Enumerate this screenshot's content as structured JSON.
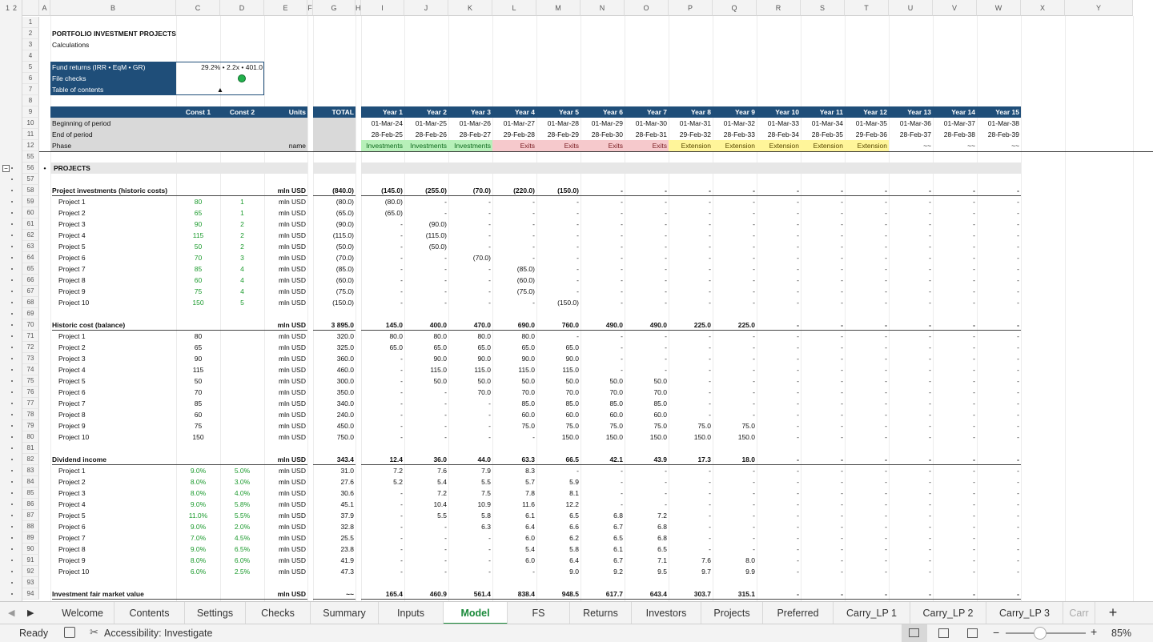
{
  "colors": {
    "accent": "#1a8a3a",
    "header": "#1f4e79",
    "investments": "#b7f0b9",
    "exits": "#f6c9cc",
    "extension": "#fff59a",
    "inputs": "#1a9a2c"
  },
  "outline_levels": [
    "1",
    "2"
  ],
  "columns": [
    "A",
    "B",
    "C",
    "D",
    "E",
    "F",
    "G",
    "H",
    "I",
    "J",
    "K",
    "L",
    "M",
    "N",
    "O",
    "P",
    "Q",
    "R",
    "S",
    "T",
    "U",
    "V",
    "W",
    "X",
    "Y"
  ],
  "title": "PORTFOLIO INVESTMENT PROJECTS",
  "subtitle": "Calculations",
  "summary": {
    "fund_returns_label": "Fund returns (IRR • EqM • GR)",
    "fund_returns_value": "29.2% • 2.2x • 401.0",
    "file_checks_label": "File checks",
    "toc_label": "Table of contents",
    "toc_icon": "▲"
  },
  "header_labels": {
    "const1": "Const 1",
    "const2": "Const 2",
    "units": "Units",
    "total": "TOTAL",
    "begin": "Beginning of period",
    "end": "End of period",
    "phase": "Phase",
    "phase_units": "name"
  },
  "years": [
    "Year 1",
    "Year 2",
    "Year 3",
    "Year 4",
    "Year 5",
    "Year 6",
    "Year 7",
    "Year 8",
    "Year 9",
    "Year 10",
    "Year 11",
    "Year 12",
    "Year 13",
    "Year 14",
    "Year 15"
  ],
  "begin_dates": [
    "01-Mar-24",
    "01-Mar-25",
    "01-Mar-26",
    "01-Mar-27",
    "01-Mar-28",
    "01-Mar-29",
    "01-Mar-30",
    "01-Mar-31",
    "01-Mar-32",
    "01-Mar-33",
    "01-Mar-34",
    "01-Mar-35",
    "01-Mar-36",
    "01-Mar-37",
    "01-Mar-38"
  ],
  "end_dates": [
    "28-Feb-25",
    "28-Feb-26",
    "28-Feb-27",
    "29-Feb-28",
    "28-Feb-29",
    "28-Feb-30",
    "28-Feb-31",
    "29-Feb-32",
    "28-Feb-33",
    "28-Feb-34",
    "28-Feb-35",
    "29-Feb-36",
    "28-Feb-37",
    "28-Feb-38",
    "28-Feb-39"
  ],
  "phases": [
    "Investments",
    "Investments",
    "Investments",
    "Exits",
    "Exits",
    "Exits",
    "Exits",
    "Extension",
    "Extension",
    "Extension",
    "Extension",
    "Extension",
    "~~",
    "~~",
    "~~"
  ],
  "section_title": "PROJECTS",
  "section_bullet": "•",
  "rows": [
    {
      "n": "1",
      "kind": "blank"
    },
    {
      "n": "2",
      "kind": "title"
    },
    {
      "n": "3",
      "kind": "subtitle"
    },
    {
      "n": "4",
      "kind": "blank"
    },
    {
      "n": "5",
      "kind": "fund"
    },
    {
      "n": "6",
      "kind": "checks"
    },
    {
      "n": "7",
      "kind": "toc"
    },
    {
      "n": "8",
      "kind": "blank"
    },
    {
      "n": "9",
      "kind": "years"
    },
    {
      "n": "10",
      "kind": "begin"
    },
    {
      "n": "11",
      "kind": "end"
    },
    {
      "n": "12",
      "kind": "phase"
    },
    {
      "n": "55",
      "kind": "blank"
    },
    {
      "n": "56",
      "kind": "section"
    },
    {
      "n": "57",
      "kind": "blank"
    },
    {
      "n": "58",
      "kind": "data",
      "bold": true,
      "label": "Project investments (historic costs)",
      "c1": "",
      "c2": "",
      "units": "mln USD",
      "total": "(840.0)",
      "vals": [
        "(145.0)",
        "(255.0)",
        "(70.0)",
        "(220.0)",
        "(150.0)",
        "-",
        "-",
        "-",
        "-",
        "-",
        "-",
        "-",
        "-",
        "-",
        "-"
      ]
    },
    {
      "n": "59",
      "kind": "data",
      "label": "Project 1",
      "c1": "80",
      "c2": "1",
      "units": "mln USD",
      "total": "(80.0)",
      "vals": [
        "(80.0)",
        "-",
        "-",
        "-",
        "-",
        "-",
        "-",
        "-",
        "-",
        "-",
        "-",
        "-",
        "-",
        "-",
        "-"
      ]
    },
    {
      "n": "60",
      "kind": "data",
      "label": "Project 2",
      "c1": "65",
      "c2": "1",
      "units": "mln USD",
      "total": "(65.0)",
      "vals": [
        "(65.0)",
        "-",
        "-",
        "-",
        "-",
        "-",
        "-",
        "-",
        "-",
        "-",
        "-",
        "-",
        "-",
        "-",
        "-"
      ]
    },
    {
      "n": "61",
      "kind": "data",
      "label": "Project 3",
      "c1": "90",
      "c2": "2",
      "units": "mln USD",
      "total": "(90.0)",
      "vals": [
        "-",
        "(90.0)",
        "-",
        "-",
        "-",
        "-",
        "-",
        "-",
        "-",
        "-",
        "-",
        "-",
        "-",
        "-",
        "-"
      ]
    },
    {
      "n": "62",
      "kind": "data",
      "label": "Project 4",
      "c1": "115",
      "c2": "2",
      "units": "mln USD",
      "total": "(115.0)",
      "vals": [
        "-",
        "(115.0)",
        "-",
        "-",
        "-",
        "-",
        "-",
        "-",
        "-",
        "-",
        "-",
        "-",
        "-",
        "-",
        "-"
      ]
    },
    {
      "n": "63",
      "kind": "data",
      "label": "Project 5",
      "c1": "50",
      "c2": "2",
      "units": "mln USD",
      "total": "(50.0)",
      "vals": [
        "-",
        "(50.0)",
        "-",
        "-",
        "-",
        "-",
        "-",
        "-",
        "-",
        "-",
        "-",
        "-",
        "-",
        "-",
        "-"
      ]
    },
    {
      "n": "64",
      "kind": "data",
      "label": "Project 6",
      "c1": "70",
      "c2": "3",
      "units": "mln USD",
      "total": "(70.0)",
      "vals": [
        "-",
        "-",
        "(70.0)",
        "-",
        "-",
        "-",
        "-",
        "-",
        "-",
        "-",
        "-",
        "-",
        "-",
        "-",
        "-"
      ]
    },
    {
      "n": "65",
      "kind": "data",
      "label": "Project 7",
      "c1": "85",
      "c2": "4",
      "units": "mln USD",
      "total": "(85.0)",
      "vals": [
        "-",
        "-",
        "-",
        "(85.0)",
        "-",
        "-",
        "-",
        "-",
        "-",
        "-",
        "-",
        "-",
        "-",
        "-",
        "-"
      ]
    },
    {
      "n": "66",
      "kind": "data",
      "label": "Project 8",
      "c1": "60",
      "c2": "4",
      "units": "mln USD",
      "total": "(60.0)",
      "vals": [
        "-",
        "-",
        "-",
        "(60.0)",
        "-",
        "-",
        "-",
        "-",
        "-",
        "-",
        "-",
        "-",
        "-",
        "-",
        "-"
      ]
    },
    {
      "n": "67",
      "kind": "data",
      "label": "Project 9",
      "c1": "75",
      "c2": "4",
      "units": "mln USD",
      "total": "(75.0)",
      "vals": [
        "-",
        "-",
        "-",
        "(75.0)",
        "-",
        "-",
        "-",
        "-",
        "-",
        "-",
        "-",
        "-",
        "-",
        "-",
        "-"
      ]
    },
    {
      "n": "68",
      "kind": "data",
      "label": "Project 10",
      "c1": "150",
      "c2": "5",
      "units": "mln USD",
      "total": "(150.0)",
      "vals": [
        "-",
        "-",
        "-",
        "-",
        "(150.0)",
        "-",
        "-",
        "-",
        "-",
        "-",
        "-",
        "-",
        "-",
        "-",
        "-"
      ]
    },
    {
      "n": "69",
      "kind": "blank"
    },
    {
      "n": "70",
      "kind": "data",
      "bold": true,
      "label": "Historic cost (balance)",
      "c1": "",
      "c2": "",
      "units": "mln USD",
      "total": "3 895.0",
      "vals": [
        "145.0",
        "400.0",
        "470.0",
        "690.0",
        "760.0",
        "490.0",
        "490.0",
        "225.0",
        "225.0",
        "-",
        "-",
        "-",
        "-",
        "-",
        "-"
      ]
    },
    {
      "n": "71",
      "kind": "data",
      "black": true,
      "label": "Project 1",
      "c1": "80",
      "c2": "",
      "units": "mln USD",
      "total": "320.0",
      "vals": [
        "80.0",
        "80.0",
        "80.0",
        "80.0",
        "-",
        "-",
        "-",
        "-",
        "-",
        "-",
        "-",
        "-",
        "-",
        "-",
        "-"
      ]
    },
    {
      "n": "72",
      "kind": "data",
      "black": true,
      "label": "Project 2",
      "c1": "65",
      "c2": "",
      "units": "mln USD",
      "total": "325.0",
      "vals": [
        "65.0",
        "65.0",
        "65.0",
        "65.0",
        "65.0",
        "-",
        "-",
        "-",
        "-",
        "-",
        "-",
        "-",
        "-",
        "-",
        "-"
      ]
    },
    {
      "n": "73",
      "kind": "data",
      "black": true,
      "label": "Project 3",
      "c1": "90",
      "c2": "",
      "units": "mln USD",
      "total": "360.0",
      "vals": [
        "-",
        "90.0",
        "90.0",
        "90.0",
        "90.0",
        "-",
        "-",
        "-",
        "-",
        "-",
        "-",
        "-",
        "-",
        "-",
        "-"
      ]
    },
    {
      "n": "74",
      "kind": "data",
      "black": true,
      "label": "Project 4",
      "c1": "115",
      "c2": "",
      "units": "mln USD",
      "total": "460.0",
      "vals": [
        "-",
        "115.0",
        "115.0",
        "115.0",
        "115.0",
        "-",
        "-",
        "-",
        "-",
        "-",
        "-",
        "-",
        "-",
        "-",
        "-"
      ]
    },
    {
      "n": "75",
      "kind": "data",
      "black": true,
      "label": "Project 5",
      "c1": "50",
      "c2": "",
      "units": "mln USD",
      "total": "300.0",
      "vals": [
        "-",
        "50.0",
        "50.0",
        "50.0",
        "50.0",
        "50.0",
        "50.0",
        "-",
        "-",
        "-",
        "-",
        "-",
        "-",
        "-",
        "-"
      ]
    },
    {
      "n": "76",
      "kind": "data",
      "black": true,
      "label": "Project 6",
      "c1": "70",
      "c2": "",
      "units": "mln USD",
      "total": "350.0",
      "vals": [
        "-",
        "-",
        "70.0",
        "70.0",
        "70.0",
        "70.0",
        "70.0",
        "-",
        "-",
        "-",
        "-",
        "-",
        "-",
        "-",
        "-"
      ]
    },
    {
      "n": "77",
      "kind": "data",
      "black": true,
      "label": "Project 7",
      "c1": "85",
      "c2": "",
      "units": "mln USD",
      "total": "340.0",
      "vals": [
        "-",
        "-",
        "-",
        "85.0",
        "85.0",
        "85.0",
        "85.0",
        "-",
        "-",
        "-",
        "-",
        "-",
        "-",
        "-",
        "-"
      ]
    },
    {
      "n": "78",
      "kind": "data",
      "black": true,
      "label": "Project 8",
      "c1": "60",
      "c2": "",
      "units": "mln USD",
      "total": "240.0",
      "vals": [
        "-",
        "-",
        "-",
        "60.0",
        "60.0",
        "60.0",
        "60.0",
        "-",
        "-",
        "-",
        "-",
        "-",
        "-",
        "-",
        "-"
      ]
    },
    {
      "n": "79",
      "kind": "data",
      "black": true,
      "label": "Project 9",
      "c1": "75",
      "c2": "",
      "units": "mln USD",
      "total": "450.0",
      "vals": [
        "-",
        "-",
        "-",
        "75.0",
        "75.0",
        "75.0",
        "75.0",
        "75.0",
        "75.0",
        "-",
        "-",
        "-",
        "-",
        "-",
        "-"
      ]
    },
    {
      "n": "80",
      "kind": "data",
      "black": true,
      "label": "Project 10",
      "c1": "150",
      "c2": "",
      "units": "mln USD",
      "total": "750.0",
      "vals": [
        "-",
        "-",
        "-",
        "-",
        "150.0",
        "150.0",
        "150.0",
        "150.0",
        "150.0",
        "-",
        "-",
        "-",
        "-",
        "-",
        "-"
      ]
    },
    {
      "n": "81",
      "kind": "blank"
    },
    {
      "n": "82",
      "kind": "data",
      "bold": true,
      "label": "Dividend income",
      "c1": "",
      "c2": "",
      "units": "mln USD",
      "total": "343.4",
      "vals": [
        "12.4",
        "36.0",
        "44.0",
        "63.3",
        "66.5",
        "42.1",
        "43.9",
        "17.3",
        "18.0",
        "-",
        "-",
        "-",
        "-",
        "-",
        "-"
      ]
    },
    {
      "n": "83",
      "kind": "data",
      "label": "Project 1",
      "c1": "9.0%",
      "c2": "5.0%",
      "units": "mln USD",
      "total": "31.0",
      "vals": [
        "7.2",
        "7.6",
        "7.9",
        "8.3",
        "-",
        "-",
        "-",
        "-",
        "-",
        "-",
        "-",
        "-",
        "-",
        "-",
        "-"
      ]
    },
    {
      "n": "84",
      "kind": "data",
      "label": "Project 2",
      "c1": "8.0%",
      "c2": "3.0%",
      "units": "mln USD",
      "total": "27.6",
      "vals": [
        "5.2",
        "5.4",
        "5.5",
        "5.7",
        "5.9",
        "-",
        "-",
        "-",
        "-",
        "-",
        "-",
        "-",
        "-",
        "-",
        "-"
      ]
    },
    {
      "n": "85",
      "kind": "data",
      "label": "Project 3",
      "c1": "8.0%",
      "c2": "4.0%",
      "units": "mln USD",
      "total": "30.6",
      "vals": [
        "-",
        "7.2",
        "7.5",
        "7.8",
        "8.1",
        "-",
        "-",
        "-",
        "-",
        "-",
        "-",
        "-",
        "-",
        "-",
        "-"
      ]
    },
    {
      "n": "86",
      "kind": "data",
      "label": "Project 4",
      "c1": "9.0%",
      "c2": "5.8%",
      "units": "mln USD",
      "total": "45.1",
      "vals": [
        "-",
        "10.4",
        "10.9",
        "11.6",
        "12.2",
        "-",
        "-",
        "-",
        "-",
        "-",
        "-",
        "-",
        "-",
        "-",
        "-"
      ]
    },
    {
      "n": "87",
      "kind": "data",
      "label": "Project 5",
      "c1": "11.0%",
      "c2": "5.5%",
      "units": "mln USD",
      "total": "37.9",
      "vals": [
        "-",
        "5.5",
        "5.8",
        "6.1",
        "6.5",
        "6.8",
        "7.2",
        "-",
        "-",
        "-",
        "-",
        "-",
        "-",
        "-",
        "-"
      ]
    },
    {
      "n": "88",
      "kind": "data",
      "label": "Project 6",
      "c1": "9.0%",
      "c2": "2.0%",
      "units": "mln USD",
      "total": "32.8",
      "vals": [
        "-",
        "-",
        "6.3",
        "6.4",
        "6.6",
        "6.7",
        "6.8",
        "-",
        "-",
        "-",
        "-",
        "-",
        "-",
        "-",
        "-"
      ]
    },
    {
      "n": "89",
      "kind": "data",
      "label": "Project 7",
      "c1": "7.0%",
      "c2": "4.5%",
      "units": "mln USD",
      "total": "25.5",
      "vals": [
        "-",
        "-",
        "-",
        "6.0",
        "6.2",
        "6.5",
        "6.8",
        "-",
        "-",
        "-",
        "-",
        "-",
        "-",
        "-",
        "-"
      ]
    },
    {
      "n": "90",
      "kind": "data",
      "label": "Project 8",
      "c1": "9.0%",
      "c2": "6.5%",
      "units": "mln USD",
      "total": "23.8",
      "vals": [
        "-",
        "-",
        "-",
        "5.4",
        "5.8",
        "6.1",
        "6.5",
        "-",
        "-",
        "-",
        "-",
        "-",
        "-",
        "-",
        "-"
      ]
    },
    {
      "n": "91",
      "kind": "data",
      "label": "Project 9",
      "c1": "8.0%",
      "c2": "6.0%",
      "units": "mln USD",
      "total": "41.9",
      "vals": [
        "-",
        "-",
        "-",
        "6.0",
        "6.4",
        "6.7",
        "7.1",
        "7.6",
        "8.0",
        "-",
        "-",
        "-",
        "-",
        "-",
        "-"
      ]
    },
    {
      "n": "92",
      "kind": "data",
      "label": "Project 10",
      "c1": "6.0%",
      "c2": "2.5%",
      "units": "mln USD",
      "total": "47.3",
      "vals": [
        "-",
        "-",
        "-",
        "-",
        "9.0",
        "9.2",
        "9.5",
        "9.7",
        "9.9",
        "-",
        "-",
        "-",
        "-",
        "-",
        "-"
      ]
    },
    {
      "n": "93",
      "kind": "blank"
    },
    {
      "n": "94",
      "kind": "data",
      "bold": true,
      "label": "Investment fair market value",
      "c1": "",
      "c2": "",
      "units": "mln USD",
      "total": "~~",
      "vals": [
        "165.4",
        "460.9",
        "561.4",
        "838.4",
        "948.5",
        "617.7",
        "643.4",
        "303.7",
        "315.1",
        "-",
        "-",
        "-",
        "-",
        "-",
        "-"
      ]
    }
  ],
  "sheet_tabs": [
    "Welcome",
    "Contents",
    "Settings",
    "Checks",
    "Summary",
    "Inputs",
    "Model",
    "FS",
    "Returns",
    "Investors",
    "Projects",
    "Preferred",
    "Carry_LP 1",
    "Carry_LP 2",
    "Carry_LP 3",
    "Carr"
  ],
  "active_tab": "Model",
  "add_sheet": "+",
  "status": {
    "ready": "Ready",
    "accessibility": "Accessibility: Investigate",
    "zoom": "85%",
    "zoom_level": 0.85
  }
}
